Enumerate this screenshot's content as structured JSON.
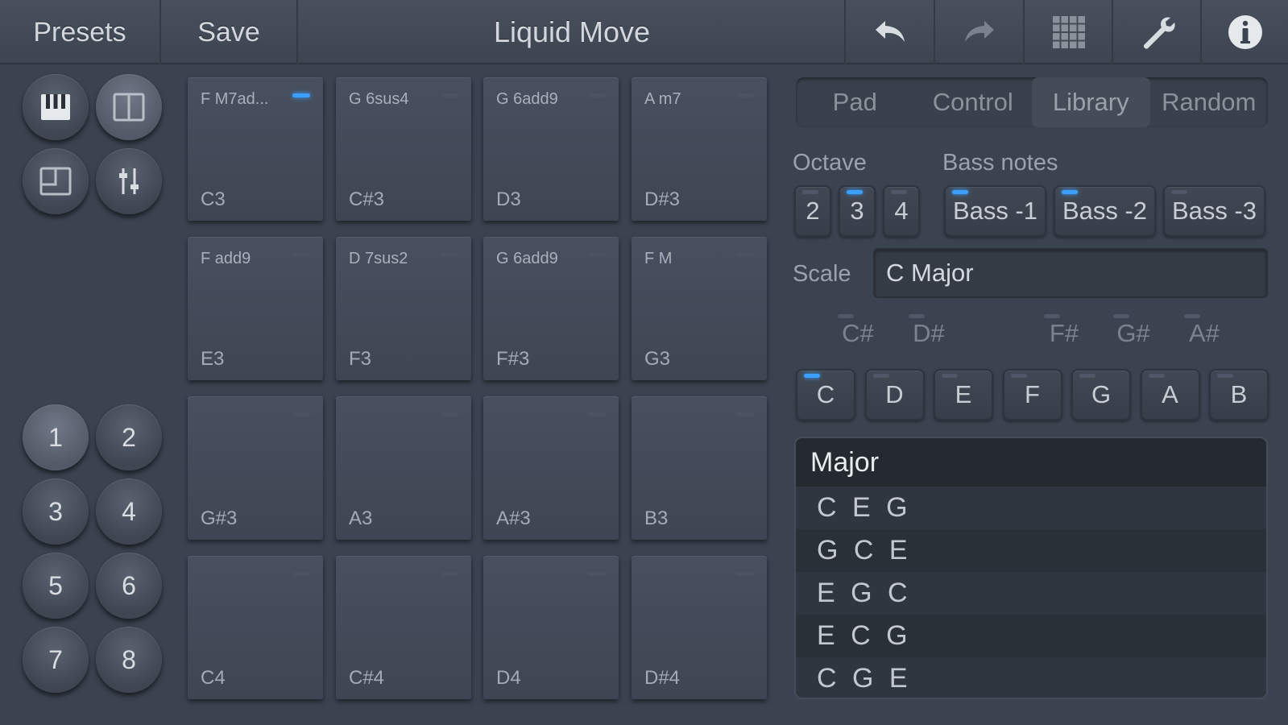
{
  "header": {
    "presets_label": "Presets",
    "save_label": "Save",
    "title": "Liquid Move",
    "icons": [
      "undo-icon",
      "redo-icon",
      "grid-icon",
      "wrench-icon",
      "info-icon"
    ]
  },
  "view_buttons": [
    "keyboard-icon",
    "split-view-icon",
    "layout-icon",
    "mixer-icon"
  ],
  "banks": [
    "1",
    "2",
    "3",
    "4",
    "5",
    "6",
    "7",
    "8"
  ],
  "active_bank": "1",
  "pads": [
    {
      "chord": "F M7ad...",
      "note": "C3",
      "led": true
    },
    {
      "chord": "G 6sus4",
      "note": "C#3",
      "led": false
    },
    {
      "chord": "G 6add9",
      "note": "D3",
      "led": false
    },
    {
      "chord": "A m7",
      "note": "D#3",
      "led": false
    },
    {
      "chord": "F add9",
      "note": "E3",
      "led": false
    },
    {
      "chord": "D 7sus2",
      "note": "F3",
      "led": false
    },
    {
      "chord": "G 6add9",
      "note": "F#3",
      "led": false
    },
    {
      "chord": "F M",
      "note": "G3",
      "led": false
    },
    {
      "chord": "",
      "note": "G#3",
      "led": false
    },
    {
      "chord": "",
      "note": "A3",
      "led": false
    },
    {
      "chord": "",
      "note": "A#3",
      "led": false
    },
    {
      "chord": "",
      "note": "B3",
      "led": false
    },
    {
      "chord": "",
      "note": "C4",
      "led": false
    },
    {
      "chord": "",
      "note": "C#4",
      "led": false
    },
    {
      "chord": "",
      "note": "D4",
      "led": false
    },
    {
      "chord": "",
      "note": "D#4",
      "led": false
    }
  ],
  "tabs": [
    "Pad",
    "Control",
    "Library",
    "Random"
  ],
  "active_tab": "Library",
  "octave": {
    "label": "Octave",
    "options": [
      "2",
      "3",
      "4"
    ],
    "selected": "3"
  },
  "bass": {
    "label": "Bass notes",
    "options": [
      "Bass -1",
      "Bass -2",
      "Bass -3"
    ],
    "active": [
      "Bass -1",
      "Bass -2"
    ]
  },
  "scale": {
    "label": "Scale",
    "value": "C Major"
  },
  "keys": {
    "sharps": [
      "C#",
      "D#",
      "F#",
      "G#",
      "A#"
    ],
    "naturals": [
      "C",
      "D",
      "E",
      "F",
      "G",
      "A",
      "B"
    ],
    "selected": "C"
  },
  "library": {
    "header": "Major",
    "rows": [
      "C E G",
      "G C E",
      "E G C",
      "E C G",
      "C G E"
    ]
  },
  "colors": {
    "accent_led": "#3aa0ff",
    "background": "#3b4350"
  }
}
